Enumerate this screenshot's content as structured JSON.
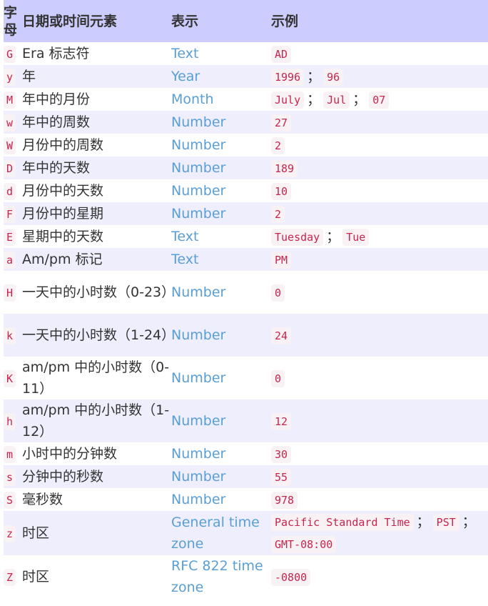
{
  "table": {
    "headers": {
      "letter": "字母",
      "element": "日期或时间元素",
      "representation": "表示",
      "example": "示例"
    },
    "rows": [
      {
        "letter": "G",
        "element": "Era 标志符",
        "representation": "Text",
        "examples": [
          "AD"
        ]
      },
      {
        "letter": "y",
        "element": "年",
        "representation": "Year",
        "examples": [
          "1996",
          "96"
        ]
      },
      {
        "letter": "M",
        "element": "年中的月份",
        "representation": "Month",
        "examples": [
          "July",
          "Jul",
          "07"
        ]
      },
      {
        "letter": "w",
        "element": "年中的周数",
        "representation": "Number",
        "examples": [
          "27"
        ]
      },
      {
        "letter": "W",
        "element": "月份中的周数",
        "representation": "Number",
        "examples": [
          "2"
        ]
      },
      {
        "letter": "D",
        "element": "年中的天数",
        "representation": "Number",
        "examples": [
          "189"
        ]
      },
      {
        "letter": "d",
        "element": "月份中的天数",
        "representation": "Number",
        "examples": [
          "10"
        ]
      },
      {
        "letter": "F",
        "element": "月份中的星期",
        "representation": "Number",
        "examples": [
          "2"
        ]
      },
      {
        "letter": "E",
        "element": "星期中的天数",
        "representation": "Text",
        "examples": [
          "Tuesday",
          "Tue"
        ]
      },
      {
        "letter": "a",
        "element": "Am/pm 标记",
        "representation": "Text",
        "examples": [
          "PM"
        ]
      },
      {
        "letter": "H",
        "element": "一天中的小时数（0-23）",
        "representation": "Number",
        "examples": [
          "0"
        ]
      },
      {
        "letter": "k",
        "element": "一天中的小时数（1-24）",
        "representation": "Number",
        "examples": [
          "24"
        ]
      },
      {
        "letter": "K",
        "element": "am/pm 中的小时数（0-11）",
        "representation": "Number",
        "examples": [
          "0"
        ]
      },
      {
        "letter": "h",
        "element": "am/pm 中的小时数（1-12）",
        "representation": "Number",
        "examples": [
          "12"
        ]
      },
      {
        "letter": "m",
        "element": "小时中的分钟数",
        "representation": "Number",
        "examples": [
          "30"
        ]
      },
      {
        "letter": "s",
        "element": "分钟中的秒数",
        "representation": "Number",
        "examples": [
          "55"
        ]
      },
      {
        "letter": "S",
        "element": "毫秒数",
        "representation": "Number",
        "examples": [
          "978"
        ]
      },
      {
        "letter": "z",
        "element": "时区",
        "representation": "General time zone",
        "examples": [
          "Pacific Standard Time",
          "PST",
          "GMT-08:00"
        ]
      },
      {
        "letter": "Z",
        "element": "时区",
        "representation": "RFC 822 time zone",
        "examples": [
          "-0800"
        ]
      }
    ],
    "example_separator": "；"
  },
  "colors": {
    "header_bg": "#ccccff",
    "alt_row_bg": "#eeeefc",
    "code_fg": "#c7254e",
    "code_bg": "#f9f2f4",
    "repr_fg": "#5a9fd4"
  }
}
